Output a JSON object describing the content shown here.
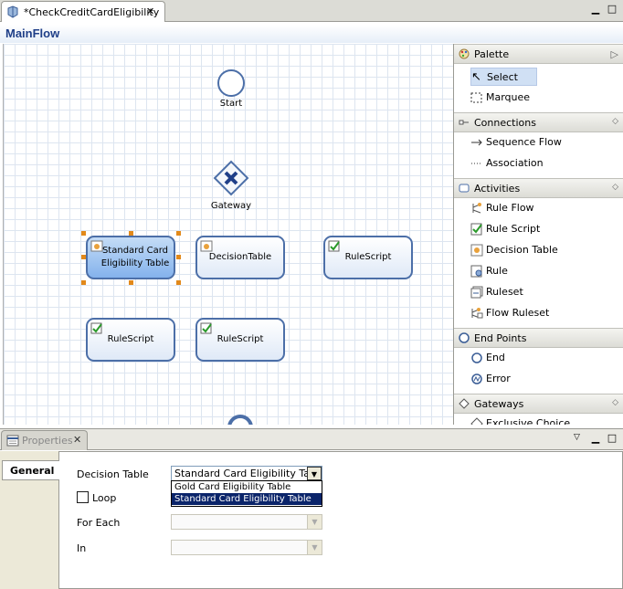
{
  "editor": {
    "tab_title": "*CheckCreditCardEligibility",
    "tab_close": "✕",
    "minimize": "▁",
    "maximize": "□",
    "flow_title": "MainFlow"
  },
  "canvas": {
    "start_label": "Start",
    "gateway_label": "Gateway",
    "nodes": {
      "standard_card": "Standard Card Eligibility Table",
      "decision_table": "DecisionTable",
      "rule_script_1": "RuleScript",
      "rule_script_2": "RuleScript",
      "rule_script_3": "RuleScript"
    }
  },
  "palette": {
    "title": "Palette",
    "select": "Select",
    "marquee": "Marquee",
    "connections": {
      "title": "Connections",
      "items": [
        "Sequence Flow",
        "Association"
      ]
    },
    "activities": {
      "title": "Activities",
      "items": [
        "Rule Flow",
        "Rule Script",
        "Decision Table",
        "Rule",
        "Ruleset",
        "Flow Ruleset"
      ]
    },
    "end_points": {
      "title": "End Points",
      "items": [
        "End",
        "Error"
      ]
    },
    "gateways": {
      "title": "Gateways",
      "items": [
        "Exclusive Choice"
      ]
    }
  },
  "properties": {
    "tab_title": "Properties",
    "section_tab": "General",
    "decision_table_label": "Decision Table",
    "decision_table_value": "Standard Card Eligibility Table",
    "dropdown_options": [
      "Gold Card Eligibility Table",
      "Standard Card Eligibility Table"
    ],
    "loop_label": "Loop",
    "for_each_label": "For Each",
    "in_label": "In",
    "for_each_value": "",
    "in_value": ""
  },
  "colors": {
    "accent": "#1f3f88",
    "selection": "#0a246a",
    "node_border": "#4c6fa8",
    "handle": "#e2891a"
  }
}
